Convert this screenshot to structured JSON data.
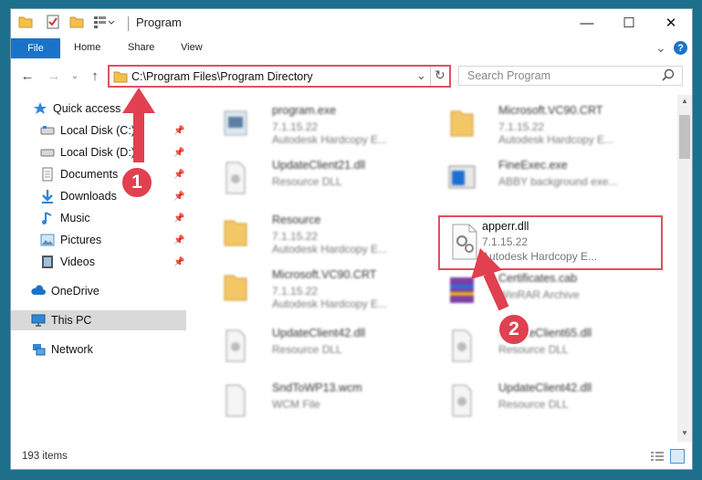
{
  "window": {
    "title": "Program",
    "controls": {
      "minimize": "—",
      "maximize": "☐",
      "close": "✕"
    }
  },
  "ribbon": {
    "tabs": [
      "File",
      "Home",
      "Share",
      "View"
    ],
    "expand": "⌄",
    "help": "?"
  },
  "address": {
    "path": "C:\\Program Files\\Program Directory",
    "search_placeholder": "Search Program"
  },
  "nav": {
    "quick_access": "Quick access",
    "items": [
      {
        "label": "Local Disk (C:)",
        "icon": "drive-icon"
      },
      {
        "label": "Local Disk (D:)",
        "icon": "drive-icon"
      },
      {
        "label": "Documents",
        "icon": "documents-icon"
      },
      {
        "label": "Downloads",
        "icon": "downloads-icon"
      },
      {
        "label": "Music",
        "icon": "music-icon"
      },
      {
        "label": "Pictures",
        "icon": "pictures-icon"
      },
      {
        "label": "Videos",
        "icon": "videos-icon"
      }
    ],
    "onedrive": "OneDrive",
    "thispc": "This PC",
    "network": "Network"
  },
  "files": [
    {
      "name": "program.exe",
      "l2": "7.1.15.22",
      "l3": "Autodesk Hardcopy E...",
      "icon": "exe"
    },
    {
      "name": "Microsoft.VC90.CRT",
      "l2": "7.1.15.22",
      "l3": "Autodesk Hardcopy E...",
      "icon": "folder"
    },
    {
      "name": "UpdateClient21.dll",
      "l2": "Resource DLL",
      "l3": "",
      "icon": "dll"
    },
    {
      "name": "FineExec.exe",
      "l2": "ABBY background exe...",
      "l3": "",
      "icon": "app"
    },
    {
      "name": "Resource",
      "l2": "7.1.15.22",
      "l3": "Autodesk Hardcopy E...",
      "icon": "folder"
    },
    {
      "name": "apperr.dll",
      "l2": "7.1.15.22",
      "l3": "Autodesk Hardcopy E...",
      "icon": "dll"
    },
    {
      "name": "Microsoft.VC90.CRT",
      "l2": "7.1.15.22",
      "l3": "Autodesk Hardcopy E...",
      "icon": "folder"
    },
    {
      "name": "Certificates.cab",
      "l2": "WinRAR Archive",
      "l3": "",
      "icon": "rar"
    },
    {
      "name": "UpdateClient42.dll",
      "l2": "Resource DLL",
      "l3": "",
      "icon": "dll"
    },
    {
      "name": "UpdateClient65.dll",
      "l2": "Resource DLL",
      "l3": "",
      "icon": "dll"
    },
    {
      "name": "SndToWP13.wcm",
      "l2": "WCM File",
      "l3": "",
      "icon": "file"
    },
    {
      "name": "UpdateClient42.dll",
      "l2": "Resource DLL",
      "l3": "",
      "icon": "dll"
    }
  ],
  "status": {
    "count": "193 items"
  },
  "annotations": {
    "step1": "1",
    "step2": "2"
  }
}
